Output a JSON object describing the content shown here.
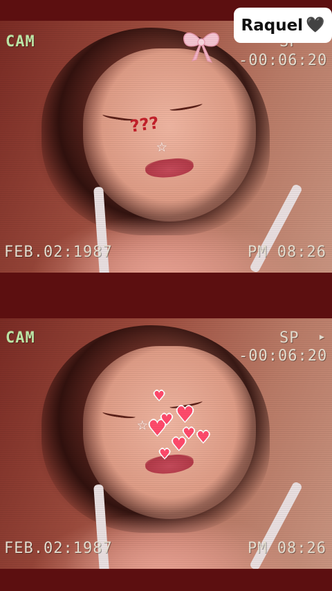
{
  "name_tag": {
    "text": "Raquel",
    "emoji": "🖤"
  },
  "top_frame": {
    "cam_label": "CAM",
    "sp_label": "SP",
    "counter": "-00:06:20",
    "date": "FEB.02:1987",
    "time": "PM 08:26",
    "stickers": {
      "bow": "pink-bow-icon",
      "question": "???",
      "star": "☆"
    }
  },
  "bottom_frame": {
    "cam_label": "CAM",
    "sp_label": "SP",
    "counter": "-00:06:20",
    "date": "FEB.02:1987",
    "time": "PM 08:26",
    "stickers": {
      "star": "☆",
      "heart": "♥"
    }
  },
  "colors": {
    "border": "#5c0f10",
    "osd": "#e6e0d2",
    "cam": "#bfe8a8",
    "heart": "#ff4a6b"
  }
}
